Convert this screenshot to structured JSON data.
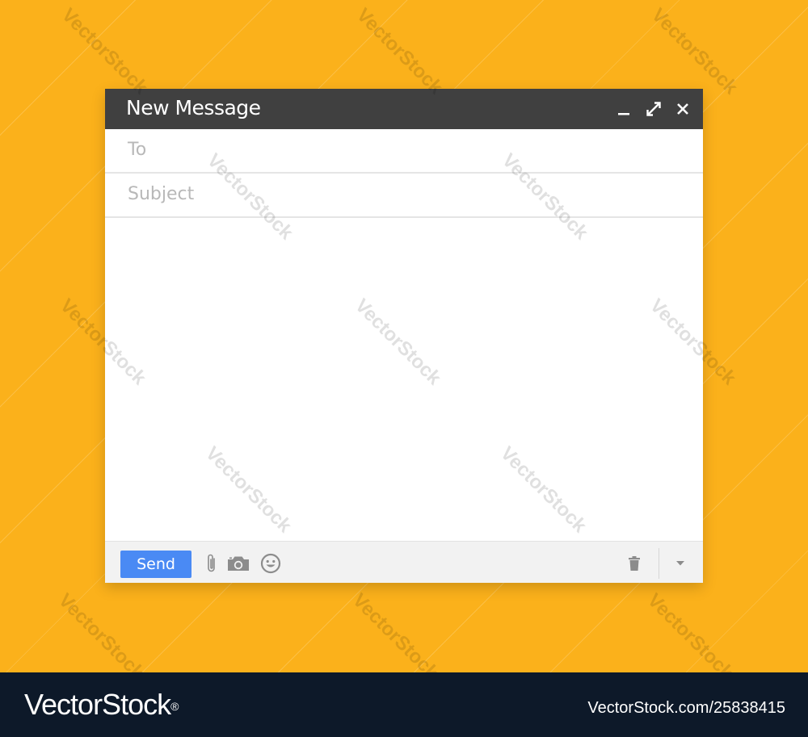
{
  "window": {
    "title": "New Message",
    "controls": {
      "minimize_icon": "minimize-icon",
      "expand_icon": "expand-icon",
      "close_icon": "close-icon"
    }
  },
  "fields": {
    "to_placeholder": "To",
    "subject_placeholder": "Subject"
  },
  "toolbar": {
    "send_label": "Send",
    "icons": [
      "paperclip-icon",
      "camera-icon",
      "emoji-icon",
      "trash-icon",
      "chevron-down-icon"
    ]
  },
  "watermark": "VectorStock",
  "footer": {
    "brand": "VectorStock",
    "brand_mark": "®",
    "image_id": "VectorStock.com/25838415"
  },
  "colors": {
    "background": "#fbb11b",
    "titlebar": "#404040",
    "send_button": "#4a8af4",
    "toolbar": "#f2f2f2",
    "footer": "#0d1929"
  }
}
